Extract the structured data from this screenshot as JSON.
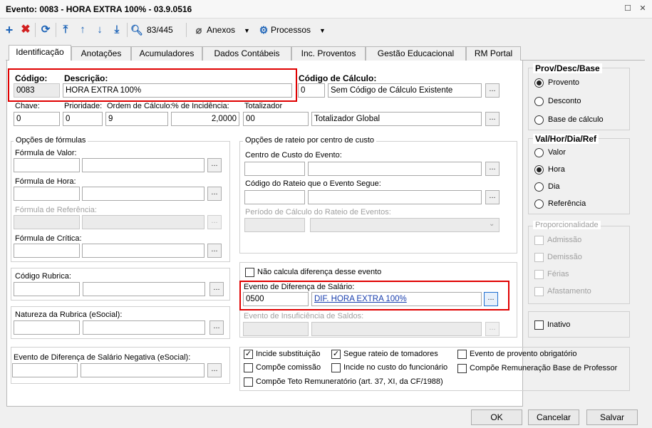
{
  "window": {
    "title": "Evento: 0083 - HORA EXTRA 100% - 03.9.0516"
  },
  "toolbar": {
    "record_counter": "83/445",
    "anexos_label": "Anexos",
    "processos_label": "Processos"
  },
  "tabs": [
    {
      "label": "Identificação",
      "active": true
    },
    {
      "label": "Anotações"
    },
    {
      "label": "Acumuladores"
    },
    {
      "label": "Dados Contábeis"
    },
    {
      "label": "Inc. Proventos"
    },
    {
      "label": "Gestão Educacional"
    },
    {
      "label": "RM Portal"
    }
  ],
  "ident": {
    "codigo_label": "Código:",
    "codigo_value": "0083",
    "descricao_label": "Descrição:",
    "descricao_value": "HORA EXTRA 100%",
    "codcalc_label": "Código de Cálculo:",
    "codcalc_value": "0",
    "codcalc_desc": "Sem Código de Cálculo Existente",
    "chave_label": "Chave:",
    "chave_value": "0",
    "prioridade_label": "Prioridade:",
    "prioridade_value": "0",
    "ordem_label": "Ordem de Cálculo:",
    "ordem_value": "9",
    "incidencia_label": "% de Incidência:",
    "incidencia_value": "2,0000",
    "totalizador_label": "Totalizador",
    "totalizador_value": "00",
    "totalizador_desc": "Totalizador Global"
  },
  "formulas": {
    "title": "Opções de fórmulas",
    "valor": "Fórmula de Valor:",
    "hora": "Fórmula de Hora:",
    "referencia": "Fórmula de Referência:",
    "critica": "Fórmula de Crítica:"
  },
  "rateio": {
    "title": "Opções de rateio por centro de custo",
    "centro": "Centro de Custo do Evento:",
    "codigo": "Código do Rateio que o Evento Segue:",
    "periodo": "Período de Cálculo do Rateio de Eventos:"
  },
  "rubrica": {
    "label": "Código Rubrica:"
  },
  "natureza": {
    "label": "Natureza da Rubrica (eSocial):"
  },
  "negativa": {
    "label": "Evento de Diferença de Salário Negativa (eSocial):"
  },
  "diferenca": {
    "nao_calcula": "Não calcula diferença desse evento",
    "evento_label": "Evento de Diferença de Salário:",
    "evento_code": "0500",
    "evento_desc": "DIF. HORA EXTRA 100%",
    "insuf_label": "Evento de Insuficiência de Saldos:"
  },
  "checks": {
    "incide_subst": "Incide substituição",
    "segue_rateio": "Segue rateio de tomadores",
    "provento_obrig": "Evento de provento obrigatório",
    "compoe_comissao": "Compõe comissão",
    "incide_custo": "Incide no custo do funcionário",
    "compoe_remun": "Compõe Remuneração Base de Professor",
    "compoe_teto": "Compõe Teto Remuneratório (art. 37, XI, da CF/1988)"
  },
  "provdesc": {
    "title": "Prov/Desc/Base",
    "options": [
      "Provento",
      "Desconto",
      "Base de cálculo"
    ],
    "selected": "Provento"
  },
  "valhora": {
    "title": "Val/Hor/Dia/Ref",
    "options": [
      "Valor",
      "Hora",
      "Dia",
      "Referência"
    ],
    "selected": "Hora"
  },
  "proporc": {
    "title": "Proporcionalidade",
    "options": [
      "Admissão",
      "Demissão",
      "Férias",
      "Afastamento"
    ]
  },
  "inativo": "Inativo",
  "buttons": {
    "ok": "OK",
    "cancelar": "Cancelar",
    "salvar": "Salvar"
  }
}
